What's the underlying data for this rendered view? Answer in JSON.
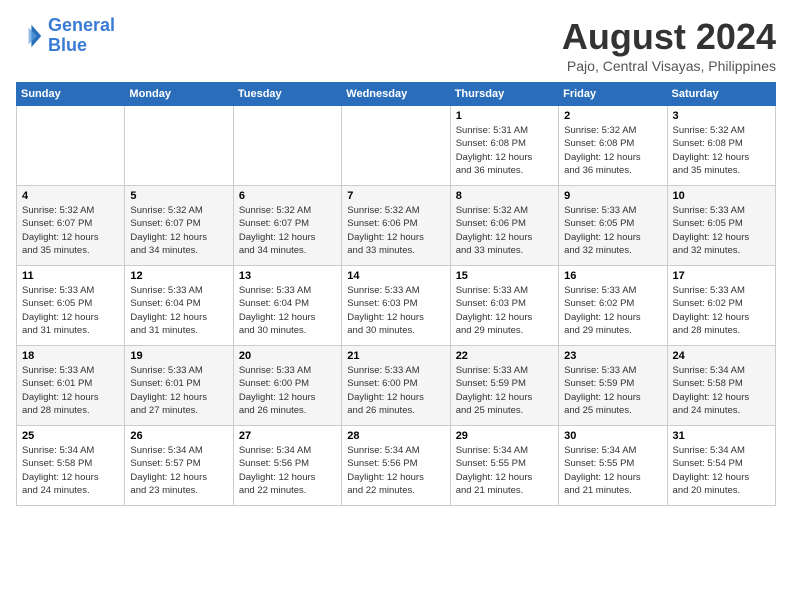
{
  "logo": {
    "line1": "General",
    "line2": "Blue"
  },
  "title": "August 2024",
  "subtitle": "Pajo, Central Visayas, Philippines",
  "weekdays": [
    "Sunday",
    "Monday",
    "Tuesday",
    "Wednesday",
    "Thursday",
    "Friday",
    "Saturday"
  ],
  "weeks": [
    [
      {
        "day": "",
        "info": ""
      },
      {
        "day": "",
        "info": ""
      },
      {
        "day": "",
        "info": ""
      },
      {
        "day": "",
        "info": ""
      },
      {
        "day": "1",
        "info": "Sunrise: 5:31 AM\nSunset: 6:08 PM\nDaylight: 12 hours\nand 36 minutes."
      },
      {
        "day": "2",
        "info": "Sunrise: 5:32 AM\nSunset: 6:08 PM\nDaylight: 12 hours\nand 36 minutes."
      },
      {
        "day": "3",
        "info": "Sunrise: 5:32 AM\nSunset: 6:08 PM\nDaylight: 12 hours\nand 35 minutes."
      }
    ],
    [
      {
        "day": "4",
        "info": "Sunrise: 5:32 AM\nSunset: 6:07 PM\nDaylight: 12 hours\nand 35 minutes."
      },
      {
        "day": "5",
        "info": "Sunrise: 5:32 AM\nSunset: 6:07 PM\nDaylight: 12 hours\nand 34 minutes."
      },
      {
        "day": "6",
        "info": "Sunrise: 5:32 AM\nSunset: 6:07 PM\nDaylight: 12 hours\nand 34 minutes."
      },
      {
        "day": "7",
        "info": "Sunrise: 5:32 AM\nSunset: 6:06 PM\nDaylight: 12 hours\nand 33 minutes."
      },
      {
        "day": "8",
        "info": "Sunrise: 5:32 AM\nSunset: 6:06 PM\nDaylight: 12 hours\nand 33 minutes."
      },
      {
        "day": "9",
        "info": "Sunrise: 5:33 AM\nSunset: 6:05 PM\nDaylight: 12 hours\nand 32 minutes."
      },
      {
        "day": "10",
        "info": "Sunrise: 5:33 AM\nSunset: 6:05 PM\nDaylight: 12 hours\nand 32 minutes."
      }
    ],
    [
      {
        "day": "11",
        "info": "Sunrise: 5:33 AM\nSunset: 6:05 PM\nDaylight: 12 hours\nand 31 minutes."
      },
      {
        "day": "12",
        "info": "Sunrise: 5:33 AM\nSunset: 6:04 PM\nDaylight: 12 hours\nand 31 minutes."
      },
      {
        "day": "13",
        "info": "Sunrise: 5:33 AM\nSunset: 6:04 PM\nDaylight: 12 hours\nand 30 minutes."
      },
      {
        "day": "14",
        "info": "Sunrise: 5:33 AM\nSunset: 6:03 PM\nDaylight: 12 hours\nand 30 minutes."
      },
      {
        "day": "15",
        "info": "Sunrise: 5:33 AM\nSunset: 6:03 PM\nDaylight: 12 hours\nand 29 minutes."
      },
      {
        "day": "16",
        "info": "Sunrise: 5:33 AM\nSunset: 6:02 PM\nDaylight: 12 hours\nand 29 minutes."
      },
      {
        "day": "17",
        "info": "Sunrise: 5:33 AM\nSunset: 6:02 PM\nDaylight: 12 hours\nand 28 minutes."
      }
    ],
    [
      {
        "day": "18",
        "info": "Sunrise: 5:33 AM\nSunset: 6:01 PM\nDaylight: 12 hours\nand 28 minutes."
      },
      {
        "day": "19",
        "info": "Sunrise: 5:33 AM\nSunset: 6:01 PM\nDaylight: 12 hours\nand 27 minutes."
      },
      {
        "day": "20",
        "info": "Sunrise: 5:33 AM\nSunset: 6:00 PM\nDaylight: 12 hours\nand 26 minutes."
      },
      {
        "day": "21",
        "info": "Sunrise: 5:33 AM\nSunset: 6:00 PM\nDaylight: 12 hours\nand 26 minutes."
      },
      {
        "day": "22",
        "info": "Sunrise: 5:33 AM\nSunset: 5:59 PM\nDaylight: 12 hours\nand 25 minutes."
      },
      {
        "day": "23",
        "info": "Sunrise: 5:33 AM\nSunset: 5:59 PM\nDaylight: 12 hours\nand 25 minutes."
      },
      {
        "day": "24",
        "info": "Sunrise: 5:34 AM\nSunset: 5:58 PM\nDaylight: 12 hours\nand 24 minutes."
      }
    ],
    [
      {
        "day": "25",
        "info": "Sunrise: 5:34 AM\nSunset: 5:58 PM\nDaylight: 12 hours\nand 24 minutes."
      },
      {
        "day": "26",
        "info": "Sunrise: 5:34 AM\nSunset: 5:57 PM\nDaylight: 12 hours\nand 23 minutes."
      },
      {
        "day": "27",
        "info": "Sunrise: 5:34 AM\nSunset: 5:56 PM\nDaylight: 12 hours\nand 22 minutes."
      },
      {
        "day": "28",
        "info": "Sunrise: 5:34 AM\nSunset: 5:56 PM\nDaylight: 12 hours\nand 22 minutes."
      },
      {
        "day": "29",
        "info": "Sunrise: 5:34 AM\nSunset: 5:55 PM\nDaylight: 12 hours\nand 21 minutes."
      },
      {
        "day": "30",
        "info": "Sunrise: 5:34 AM\nSunset: 5:55 PM\nDaylight: 12 hours\nand 21 minutes."
      },
      {
        "day": "31",
        "info": "Sunrise: 5:34 AM\nSunset: 5:54 PM\nDaylight: 12 hours\nand 20 minutes."
      }
    ]
  ]
}
